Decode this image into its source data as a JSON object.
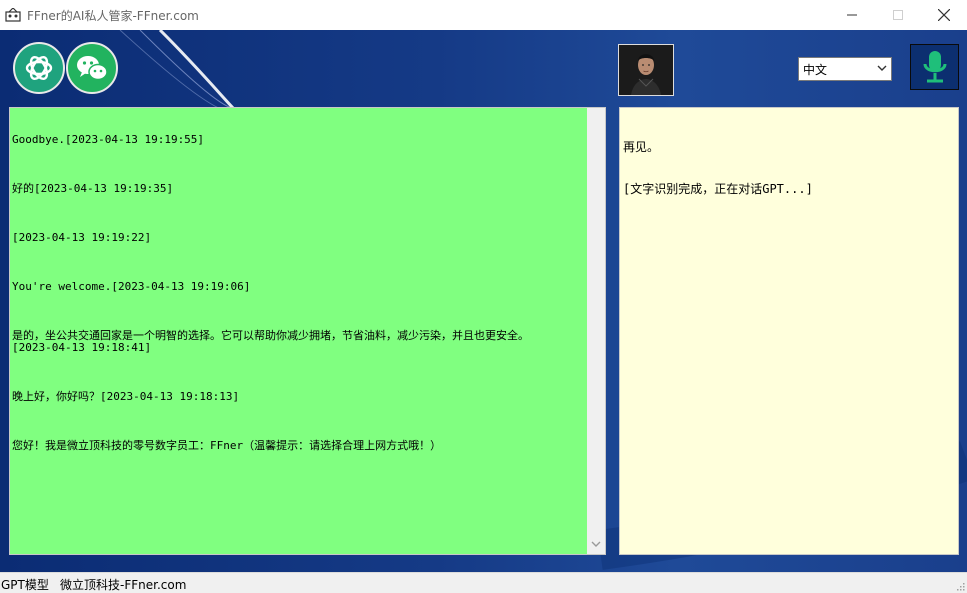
{
  "window": {
    "title": "FFner的AI私人管家-FFner.com"
  },
  "toolbar": {
    "language": {
      "selected": "中文"
    }
  },
  "chat_log": {
    "messages": [
      "Goodbye.[2023-04-13 19:19:55]",
      "好的[2023-04-13 19:19:35]",
      "[2023-04-13 19:19:22]",
      "You're welcome.[2023-04-13 19:19:06]",
      "是的，坐公共交通回家是一个明智的选择。它可以帮助你减少拥堵，节省油料，减少污染，并且也更安全。\n[2023-04-13 19:18:41]",
      "晚上好，你好吗？[2023-04-13 19:18:13]",
      "您好！我是微立顶科技的零号数字员工：FFner（温馨提示：请选择合理上网方式哦！）"
    ]
  },
  "result_panel": {
    "lines": [
      "再见。",
      "[文字识别完成，正在对话GPT...]"
    ]
  },
  "statusbar": {
    "model": "GPT模型",
    "company": "微立顶科技-FFner.com"
  },
  "colors": {
    "chat_bg": "#80ff80",
    "result_bg": "#ffffdc",
    "mic_accent": "#1fbf7a",
    "window_bg": "#153a86"
  },
  "icons": [
    "app-icon",
    "openai-logo-icon",
    "wechat-logo-icon",
    "avatar-image",
    "microphone-icon",
    "chevron-down-icon"
  ]
}
